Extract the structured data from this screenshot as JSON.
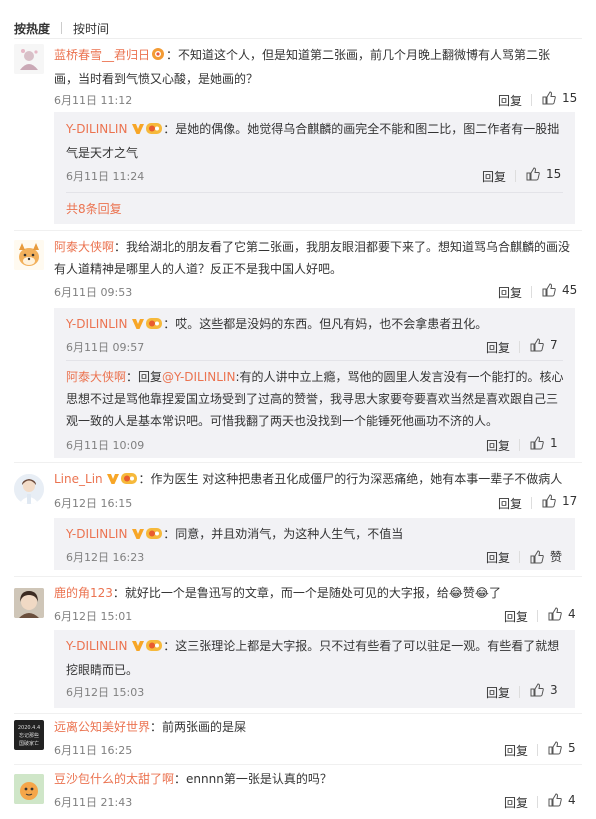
{
  "tabs": {
    "hot": "按热度",
    "time": "按时间"
  },
  "comments": [
    {
      "user": "蓝桥春雪__君归日",
      "text_l1": "：不知道这个人，但是知道第二张画，前几个月晚上翻微博有人骂第二张",
      "text_l2": "画，当时看到气愤又心酸，是她画的？",
      "date": "6月11日 11:12",
      "reply": "回复",
      "likes": "15",
      "replies": [
        {
          "user": "Y-DILINLIN",
          "text_l1": "：是她的偶像。她觉得乌合麒麟的画完全不能和图二比，图二作者有一股拙",
          "text_l2": "气是天才之气",
          "date": "6月11日 11:24",
          "reply": "回复",
          "likes": "15"
        }
      ],
      "more": "共8条回复"
    },
    {
      "user": "阿泰大侠啊",
      "text_l1": "：我给湖北的朋友看了它第二张画，我朋友眼泪都要下来了。想知道骂乌合麒麟的画没",
      "text_l2": "有人道精神是哪里人的人道？反正不是我中国人好吧。",
      "date": "6月11日 09:53",
      "reply": "回复",
      "likes": "45",
      "replies": [
        {
          "user": "Y-DILINLIN",
          "text_l1": "：哎。这些都是没妈的东西。但凡有妈，也不会拿患者丑化。",
          "date": "6月11日 09:57",
          "reply": "回复",
          "likes": "7"
        },
        {
          "user": "阿泰大侠啊",
          "prefix": "：回复",
          "mention": "@Y-DILINLIN",
          "text_l1": ":有的人讲中立上瘾，骂他的圆里人发言没有一个能打的。核心",
          "text_l2": "思想不过是骂他靠捏爱国立场受到了过高的赞誉，我寻思大家要夸要喜欢当然是喜欢跟自己三",
          "text_l3": "观一致的人是基本常识吧。可惜我翻了两天也没找到一个能锤死他画功不济的人。",
          "date": "6月11日 10:09",
          "reply": "回复",
          "likes": "1"
        }
      ]
    },
    {
      "user": "Line_Lin",
      "text_l1": "：作为医生 对这种把患者丑化成僵尸的行为深恶痛绝，她有本事一辈子不做病人",
      "date": "6月12日 16:15",
      "reply": "回复",
      "likes": "17",
      "replies": [
        {
          "user": "Y-DILINLIN",
          "text_l1": "：同意，并且劝消气，为这种人生气，不值当",
          "date": "6月12日 16:23",
          "reply": "回复",
          "likes": "赞"
        }
      ]
    },
    {
      "user": "鹿的角123",
      "text_l1": "：就好比一个是鲁迅写的文章，而一个是随处可见的大字报，给😂赞😂了",
      "date": "6月12日 15:01",
      "reply": "回复",
      "likes": "4",
      "replies": [
        {
          "user": "Y-DILINLIN",
          "text_l1": "：这三张理论上都是大字报。只不过有些看了可以驻足一观。有些看了就想",
          "text_l2": "挖眼睛而已。",
          "date": "6月12日 15:03",
          "reply": "回复",
          "likes": "3"
        }
      ]
    },
    {
      "user": "远离公知美好世界",
      "avatar_text": [
        "2020.4.4",
        "忘记那些",
        "国破家亡"
      ],
      "text_l1": "：前两张画的是屎",
      "date": "6月11日 16:25",
      "reply": "回复",
      "likes": "5"
    },
    {
      "user": "豆沙包什么的太甜了啊",
      "text_l1": "：ennnn第一张是认真的吗？",
      "date": "6月11日 21:43",
      "reply": "回复",
      "likes": "4"
    }
  ],
  "colors": {
    "username": "#eb7350",
    "reply_bg": "#f2f2f5",
    "meta": "#808080"
  },
  "icons": {
    "like": "thumb-up-icon",
    "vip": "vip-v-icon",
    "fan_badge": "fan-badge-icon"
  }
}
